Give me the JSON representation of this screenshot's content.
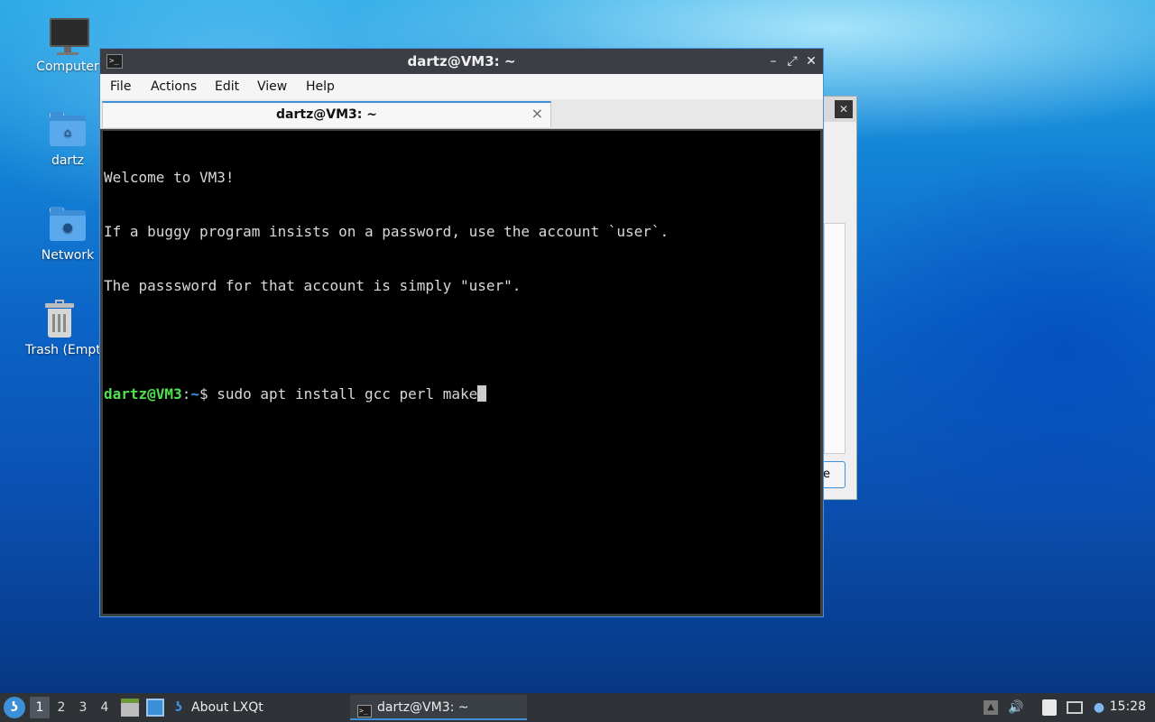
{
  "desktop": {
    "icons": [
      {
        "label": "Computer",
        "icon": "computer-icon"
      },
      {
        "label": "dartz",
        "icon": "home-folder-icon"
      },
      {
        "label": "Network",
        "icon": "network-folder-icon"
      },
      {
        "label": "Trash (Empty)",
        "icon": "trash-icon"
      }
    ]
  },
  "background_dialog": {
    "close_glyph": "✕",
    "button_fragment": "e"
  },
  "terminal": {
    "title": "dartz@VM3: ~",
    "controls": {
      "minimize": "–",
      "maximize": "⤢",
      "close": "✕"
    },
    "menu": [
      "File",
      "Actions",
      "Edit",
      "View",
      "Help"
    ],
    "tab": {
      "label": "dartz@VM3: ~",
      "close": "×"
    },
    "output_lines": [
      "Welcome to VM3!",
      "If a buggy program insists on a password, use the account `user`.",
      "The passsword for that account is simply \"user\"."
    ],
    "prompt": {
      "user_host": "dartz@VM3",
      "sep": ":",
      "path": "~",
      "symbol": "$ "
    },
    "command": "sudo apt install gcc perl make"
  },
  "taskbar": {
    "workspaces": [
      "1",
      "2",
      "3",
      "4"
    ],
    "active_workspace": "1",
    "tasks": [
      {
        "label": "About LXQt",
        "icon": "lxqt-icon"
      },
      {
        "label": "dartz@VM3: ~",
        "icon": "terminal-icon"
      }
    ],
    "clock": "15:28"
  }
}
